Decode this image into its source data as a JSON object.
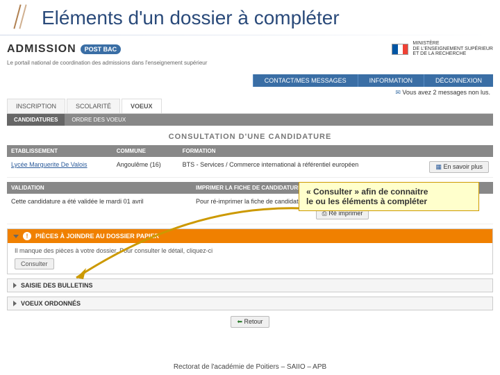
{
  "slide": {
    "title": "Eléments d'un dossier à compléter",
    "footer": "Rectorat de l'académie de Poitiers – SAIIO – APB"
  },
  "branding": {
    "admission": "ADMISSION",
    "postbac": "POST BAC",
    "subtitle": "Le portail national de coordination des admissions dans l'enseignement supérieur",
    "ministry_line1": "MINISTÈRE",
    "ministry_line2": "DE L'ENSEIGNEMENT SUPÉRIEUR",
    "ministry_line3": "ET DE LA RECHERCHE"
  },
  "nav_top": {
    "contact": "CONTACT/MES MESSAGES",
    "info": "INFORMATION",
    "logout": "DÉCONNEXION"
  },
  "messages_notice": "Vous avez 2 messages non lus.",
  "nav_main": {
    "inscription": "INSCRIPTION",
    "scolarite": "SCOLARITÉ",
    "voeux": "VOEUX"
  },
  "nav_sub": {
    "candidatures": "CANDIDATURES",
    "ordre": "ORDRE DES VOEUX"
  },
  "section_title": "CONSULTATION D'UNE CANDIDATURE",
  "table": {
    "headers": {
      "etab": "ETABLISSEMENT",
      "commune": "COMMUNE",
      "formation": "FORMATION"
    },
    "row": {
      "etab": "Lycée Marguerite De Valois",
      "commune": "Angoulême (16)",
      "formation": "BTS - Services / Commerce international à référentiel européen",
      "more_btn": "En savoir plus"
    }
  },
  "validation": {
    "header_left": "VALIDATION",
    "header_right": "IMPRIMER LA FICHE DE CANDIDATURE",
    "left_text": "Cette candidature a été validée le mardi 01 avril",
    "right_text": "Pour ré-imprimer la fiche de candidature, cliquez ci-dessous",
    "reimprimer_btn": "Ré imprimer"
  },
  "pieces": {
    "header": "PIÈCES À JOINDRE AU DOSSIER PAPIER",
    "body_text": "Il manque des pièces à votre dossier. Pour consulter le détail, cliquez-ci",
    "consulter_btn": "Consulter"
  },
  "bulletins": {
    "header": "SAISIE DES BULLETINS"
  },
  "voeux_ord": {
    "header": "VOEUX ORDONNÉS"
  },
  "retour_btn": "Retour",
  "callout": {
    "line1": "« Consulter » afin de connaitre",
    "line2": "le ou les éléments à compléter"
  }
}
